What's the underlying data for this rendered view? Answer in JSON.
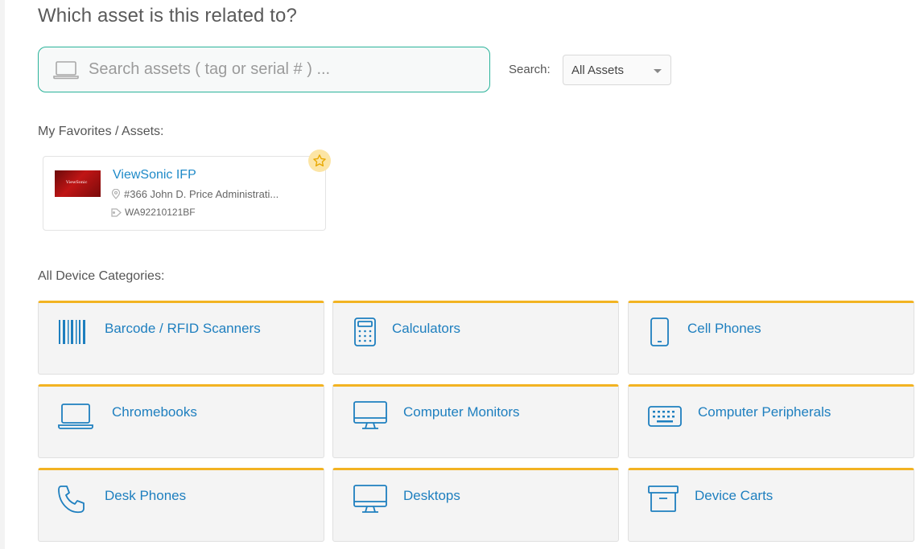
{
  "page": {
    "title": "Which asset is this related to?"
  },
  "search": {
    "placeholder": "Search assets ( tag or serial # ) ...",
    "value": "",
    "scope_label": "Search:",
    "scope_selected": "All Assets"
  },
  "favorites": {
    "heading": "My Favorites / Assets:",
    "items": [
      {
        "name": "ViewSonic IFP",
        "location": "#366 John D. Price Administrati...",
        "tag": "WA92210121BF",
        "thumbnail_text": "ViewSonic",
        "favorite_icon": "star-icon"
      }
    ]
  },
  "categories": {
    "heading": "All Device Categories:",
    "items": [
      {
        "label": "Barcode / RFID Scanners",
        "icon": "barcode-icon"
      },
      {
        "label": "Calculators",
        "icon": "calculator-icon"
      },
      {
        "label": "Cell Phones",
        "icon": "cell-phone-icon"
      },
      {
        "label": "Chromebooks",
        "icon": "laptop-icon"
      },
      {
        "label": "Computer Monitors",
        "icon": "monitor-icon"
      },
      {
        "label": "Computer Peripherals",
        "icon": "keyboard-icon"
      },
      {
        "label": "Desk Phones",
        "icon": "phone-icon"
      },
      {
        "label": "Desktops",
        "icon": "desktop-icon"
      },
      {
        "label": "Device Carts",
        "icon": "archive-box-icon"
      }
    ]
  },
  "colors": {
    "accent_teal": "#2ab39a",
    "link_blue": "#1e7fbf",
    "card_top_border": "#f2b322",
    "star_badge": "#fce5a5"
  }
}
